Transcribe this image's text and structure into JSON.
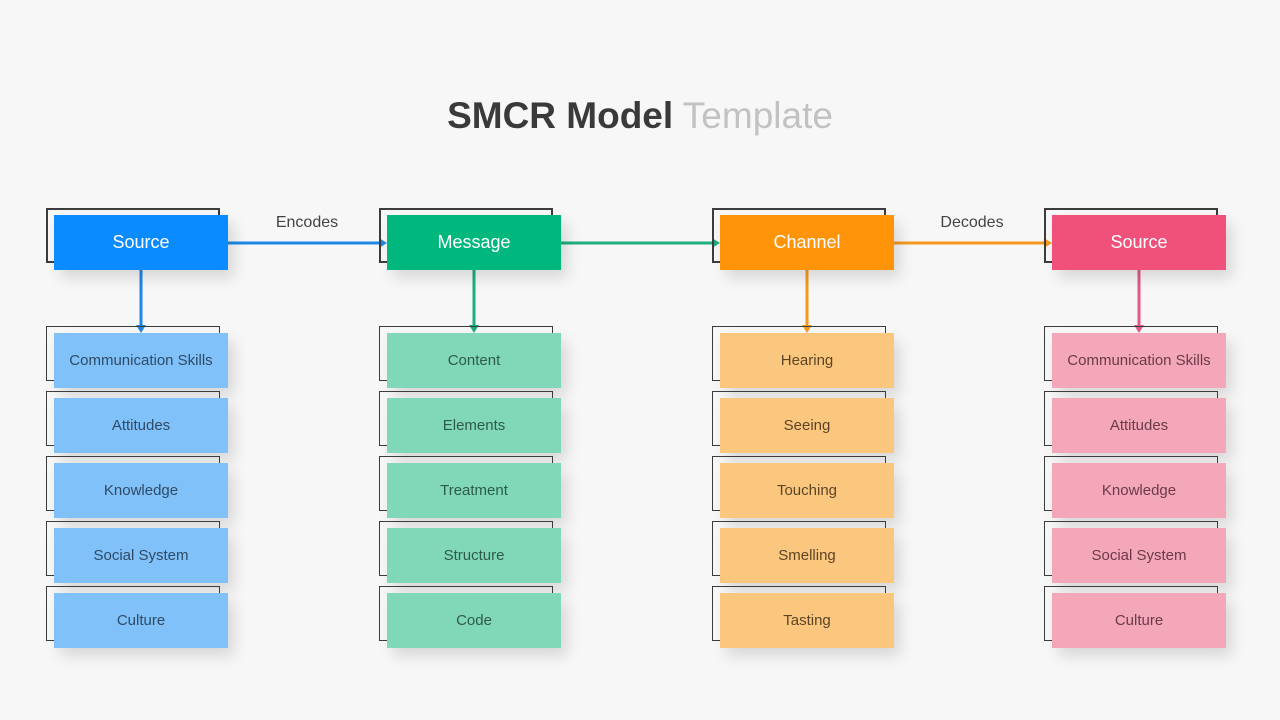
{
  "title": {
    "bold": "SMCR Model",
    "light": "Template"
  },
  "connectors": [
    {
      "label": "Encodes",
      "color": "#1e88e5"
    },
    {
      "label": "",
      "color": "#1fae7f"
    },
    {
      "label": "Decodes",
      "color": "#f39a1e"
    }
  ],
  "columns": [
    {
      "heading": "Source",
      "head_color": "#0a8bff",
      "item_color": "#7fc1f8",
      "item_text_color": "#2f4a66",
      "arrow_color": "#1e88e5",
      "items": [
        "Communication Skills",
        "Attitudes",
        "Knowledge",
        "Social System",
        "Culture"
      ]
    },
    {
      "heading": "Message",
      "head_color": "#00b77e",
      "item_color": "#80d8b8",
      "item_text_color": "#2e5a4a",
      "arrow_color": "#1fae7f",
      "items": [
        "Content",
        "Elements",
        "Treatment",
        "Structure",
        "Code"
      ]
    },
    {
      "heading": "Channel",
      "head_color": "#ff9408",
      "item_color": "#fbc77f",
      "item_text_color": "#5c4426",
      "arrow_color": "#f39a1e",
      "items": [
        "Hearing",
        "Seeing",
        "Touching",
        "Smelling",
        "Tasting"
      ]
    },
    {
      "heading": "Source",
      "head_color": "#f0517a",
      "item_color": "#f4a7b9",
      "item_text_color": "#6a3a48",
      "arrow_color": "#e05a84",
      "items": [
        "Communication Skills",
        "Attitudes",
        "Knowledge",
        "Social System",
        "Culture"
      ]
    }
  ]
}
